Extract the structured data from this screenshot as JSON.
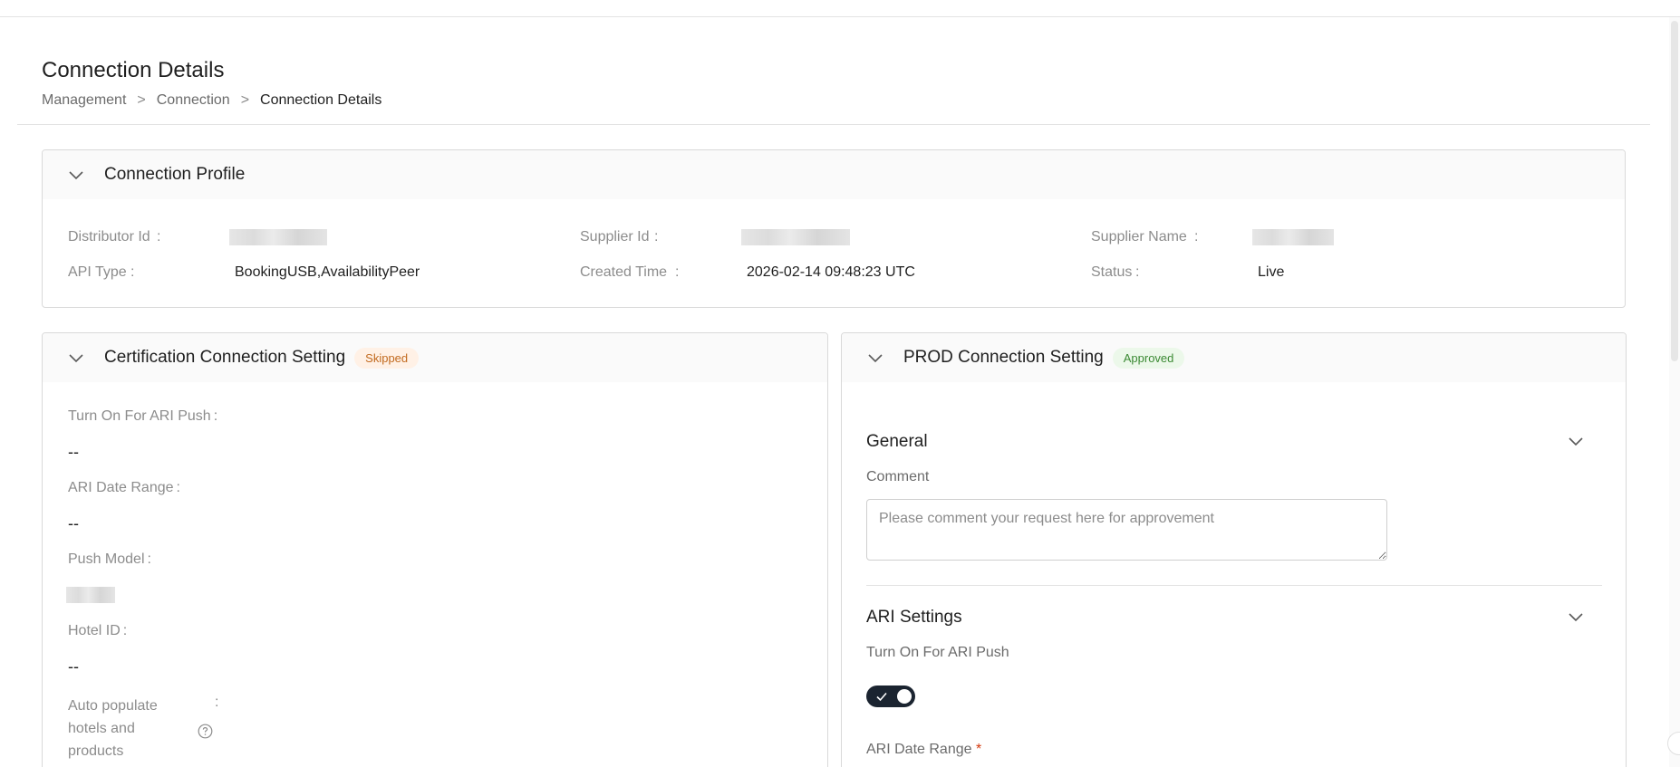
{
  "page": {
    "title": "Connection Details",
    "breadcrumb": [
      "Management",
      "Connection",
      "Connection Details"
    ],
    "breadcrumb_separator": ">"
  },
  "profile": {
    "title": "Connection Profile",
    "fields": {
      "distributor_id": {
        "label": "Distributor Id",
        "value": ""
      },
      "supplier_id": {
        "label": "Supplier Id",
        "value": ""
      },
      "supplier_name": {
        "label": "Supplier Name",
        "value": ""
      },
      "api_type": {
        "label": "API Type",
        "value": "BookingUSB,AvailabilityPeer"
      },
      "created_time": {
        "label": "Created Time",
        "value": "2026-02-14 09:48:23 UTC"
      },
      "status": {
        "label": "Status",
        "value": "Live"
      }
    },
    "colon": ":"
  },
  "cert": {
    "title": "Certification Connection Setting",
    "badge": "Skipped",
    "fields": {
      "ari_push": {
        "label": "Turn On For ARI Push",
        "value": "--"
      },
      "ari_date_range": {
        "label": "ARI Date Range",
        "value": "--"
      },
      "push_model": {
        "label": "Push Model",
        "value": ""
      },
      "hotel_id": {
        "label": "Hotel ID",
        "value": "--"
      },
      "auto_populate": {
        "label_lines": [
          "Auto populate",
          "hotels and",
          "products"
        ]
      }
    }
  },
  "prod": {
    "title": "PROD Connection Setting",
    "badge": "Approved",
    "general": {
      "title": "General",
      "comment_label": "Comment",
      "comment_placeholder": "Please comment your request here for approvement",
      "comment_value": ""
    },
    "ari": {
      "title": "ARI Settings",
      "push_label": "Turn On For ARI Push",
      "push_enabled": true,
      "date_range_label": "ARI Date Range",
      "required_mark": "*"
    }
  },
  "colors": {
    "toggle_on": "#1b2430",
    "skipped_badge_bg": "#fff1e6",
    "skipped_badge_text": "#c26a1f",
    "approved_badge_bg": "#ecf8ea",
    "approved_badge_text": "#3c8a34",
    "required": "#d4380d"
  },
  "icons": {
    "collapse": "chevron-down-icon",
    "help": "question-circle-icon",
    "check": "check-icon"
  }
}
